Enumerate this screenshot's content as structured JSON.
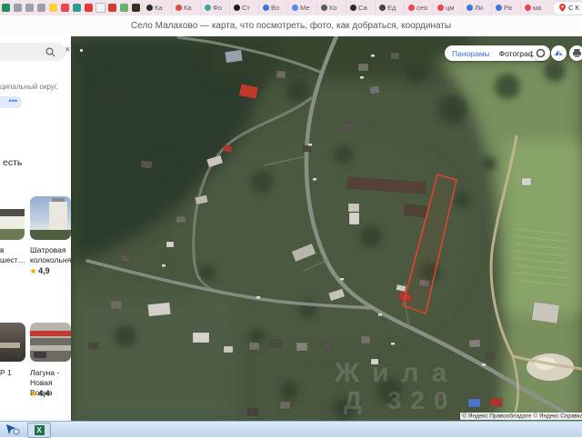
{
  "browser": {
    "toolbar_title": "Село Малахово — карта, что посмотреть, фото, как добраться, координаты",
    "tab_strip": {
      "pinned_tabs": [
        {
          "icon": "excel-icon",
          "color": "#1e8e5a"
        },
        {
          "icon": "sheet-icon",
          "color": "#9aa0a6"
        },
        {
          "icon": "sheet-icon",
          "color": "#9aa0a6"
        },
        {
          "icon": "sheet-icon",
          "color": "#9aa0a6"
        },
        {
          "icon": "yandex-icon",
          "color": "#ffcf40"
        },
        {
          "icon": "red-dot-icon",
          "color": "#e5484d"
        },
        {
          "icon": "chart-icon",
          "color": "#2e9e8f"
        },
        {
          "icon": "youtube-icon",
          "color": "#e53935"
        },
        {
          "icon": "doc-icon",
          "color": "#f4f4f4"
        },
        {
          "icon": "red-circle-icon",
          "color": "#d23f31"
        },
        {
          "icon": "palette-icon",
          "color": "#67b26f"
        },
        {
          "icon": "dark-square-icon",
          "color": "#3d2f1f"
        }
      ],
      "tabs": [
        {
          "label": "Ка",
          "icon_color": "#2b2b2b"
        },
        {
          "label": "Ка",
          "icon_color": "#d94f43"
        },
        {
          "label": "Фо",
          "icon_color": "#3aa3a0"
        },
        {
          "label": "Ст",
          "icon_color": "#1c1c1c"
        },
        {
          "label": "Во",
          "icon_color": "#3b78d8"
        },
        {
          "label": "Ме",
          "icon_color": "#4d8fe8"
        },
        {
          "label": "Ко",
          "icon_color": "#5a5a5a"
        },
        {
          "label": "Са",
          "icon_color": "#2b2b2b"
        },
        {
          "label": "Ед",
          "icon_color": "#444444"
        },
        {
          "label": "сео",
          "icon_color": "#e5484d"
        },
        {
          "label": "цм",
          "icon_color": "#e5484d"
        },
        {
          "label": "Ли",
          "icon_color": "#3b78d8"
        },
        {
          "label": "Ра",
          "icon_color": "#3b78d8"
        },
        {
          "label": "ма",
          "icon_color": "#e5484d"
        }
      ],
      "active_tab": {
        "label": "С К",
        "icon": "map-pin-icon"
      },
      "new_tab_button": "+"
    }
  },
  "sidebar": {
    "search_close": "×",
    "snippet_line": "ципальный округ,",
    "more_chip": "•••",
    "heading_fragment": "есть",
    "cards": [
      {
        "line1": "в",
        "line2": "шест…",
        "rating": ""
      },
      {
        "line1": "Шатровая",
        "line2": "колокольня",
        "rating": "4,9"
      },
      {
        "line1": "Р 1",
        "line2": "",
        "rating": ""
      },
      {
        "line1": "Лагуна - Новая",
        "line2": "Волна",
        "rating": "4,4"
      }
    ]
  },
  "map": {
    "controls": {
      "panoramas": "Панорамы",
      "photos": "Фотографии"
    },
    "watermark_line1": "Жила",
    "watermark_line2": "Д 320",
    "copyright_left": "© Яндекс  Правообладатели",
    "copyright_right": "© Яндекс  Справка",
    "plot_outline_color": "#e2432e"
  }
}
